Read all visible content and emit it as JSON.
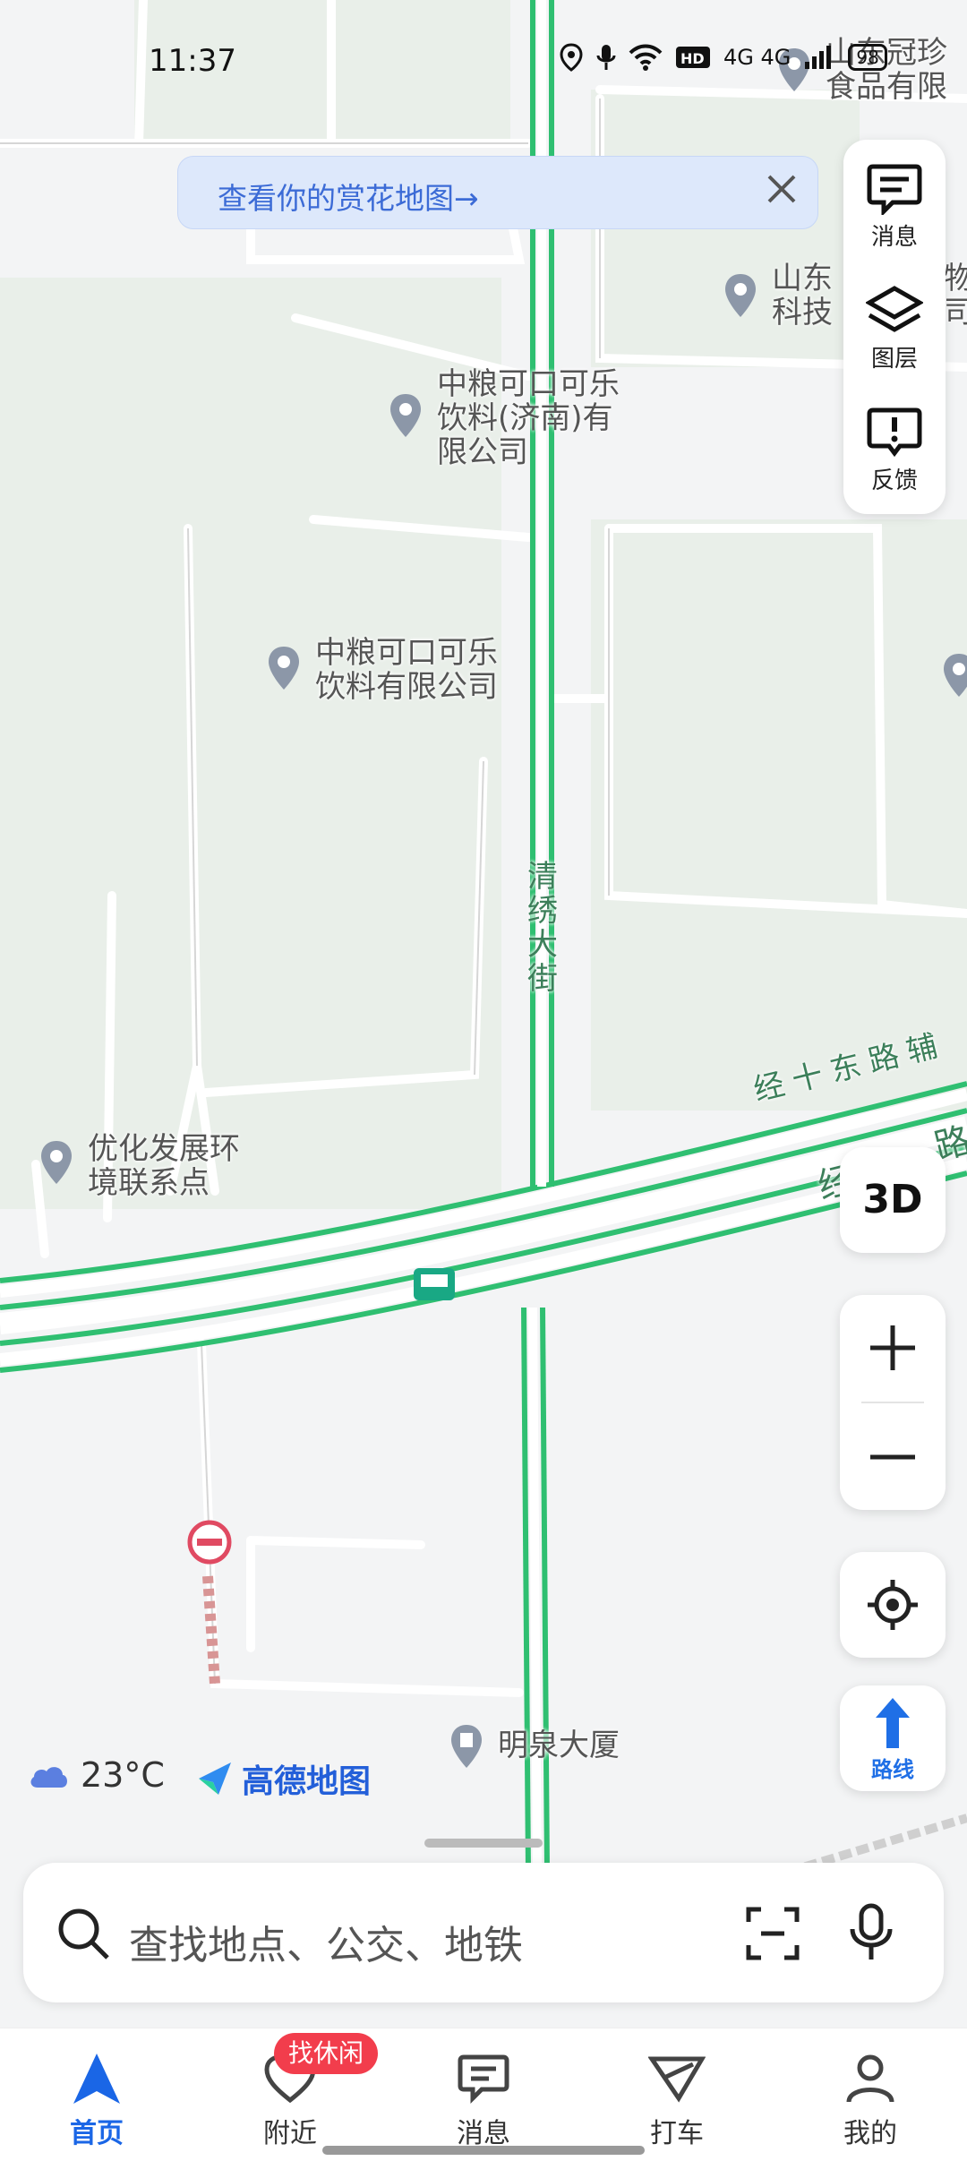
{
  "status_bar": {
    "time": "11:37",
    "network": "4G 4G",
    "battery": "98"
  },
  "banner": {
    "text": "查看你的赏花地图→"
  },
  "side_panel": [
    {
      "label": "消息",
      "icon": "message-icon"
    },
    {
      "label": "图层",
      "icon": "layers-icon"
    },
    {
      "label": "反馈",
      "icon": "feedback-icon"
    }
  ],
  "map": {
    "pois": [
      {
        "lines": [
          "山东冠珍",
          "食品有限"
        ]
      },
      {
        "lines": [
          "山东",
          "科技"
        ]
      },
      {
        "lines": [
          "物",
          "司"
        ]
      },
      {
        "lines": [
          "中粮可口可乐",
          "饮料(济南)有",
          "限公司"
        ]
      },
      {
        "lines": [
          "中粮可口可乐",
          "饮料有限公司"
        ]
      },
      {
        "lines": [
          "优化发展环",
          "境联系点"
        ]
      },
      {
        "lines": [
          "明泉大厦"
        ]
      }
    ],
    "roads": [
      "清",
      "绣",
      "大",
      "街"
    ],
    "road_east": "经十东路辅",
    "road_east2": "经",
    "road_east3": "路"
  },
  "controls": {
    "three_d": "3D",
    "route": "路线"
  },
  "weather": {
    "temp": "23°C"
  },
  "brand": {
    "name": "高德地图"
  },
  "search": {
    "placeholder": "查找地点、公交、地铁"
  },
  "tabs": [
    {
      "label": "首页",
      "active": true
    },
    {
      "label": "附近",
      "active": false
    },
    {
      "label": "消息",
      "active": false
    },
    {
      "label": "打车",
      "active": false
    },
    {
      "label": "我的",
      "active": false
    }
  ],
  "badge": "找休闲",
  "colors": {
    "road": "#2fbf71",
    "accent": "#1a66e6",
    "badge": "#f23d4c"
  }
}
